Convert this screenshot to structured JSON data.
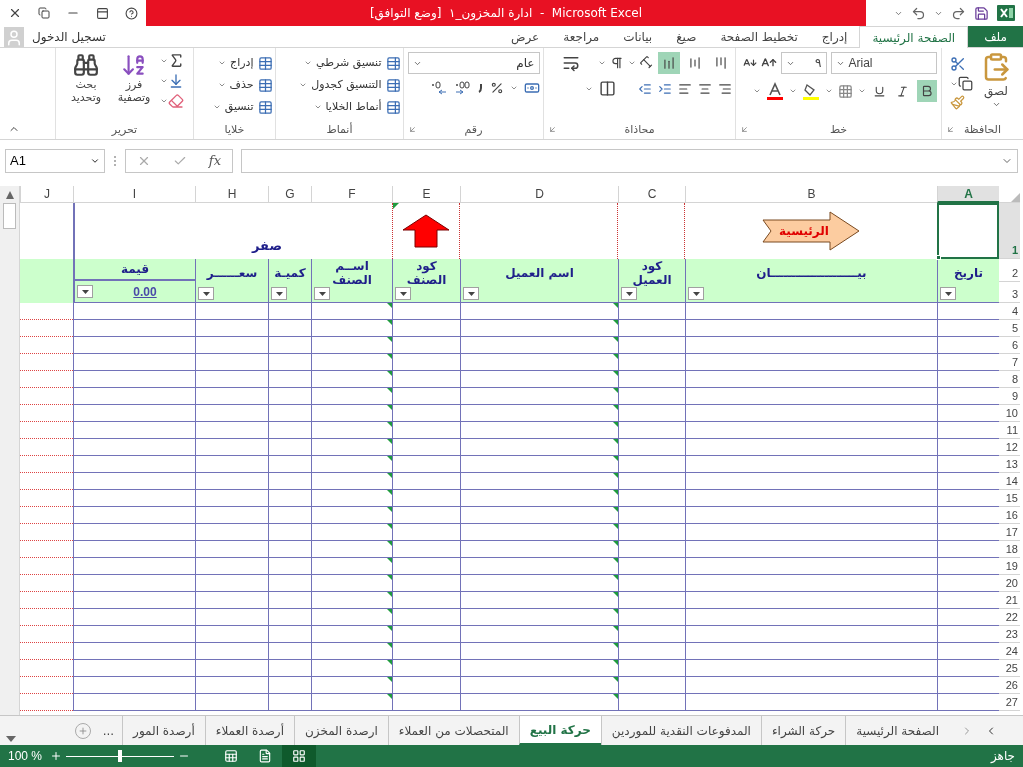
{
  "window": {
    "title": "ادارة المخزون_١  [وضع التوافق]  -  Microsoft Excel"
  },
  "account": {
    "label": "تسجيل الدخول"
  },
  "ribbon_tabs": [
    {
      "label": "ملف",
      "kind": "file",
      "selected": false
    },
    {
      "label": "الصفحة الرئيسية",
      "kind": "tab",
      "selected": true
    },
    {
      "label": "إدراج",
      "kind": "tab",
      "selected": false
    },
    {
      "label": "تخطيط الصفحة",
      "kind": "tab",
      "selected": false
    },
    {
      "label": "صيغ",
      "kind": "tab",
      "selected": false
    },
    {
      "label": "بيانات",
      "kind": "tab",
      "selected": false
    },
    {
      "label": "مراجعة",
      "kind": "tab",
      "selected": false
    },
    {
      "label": "عرض",
      "kind": "tab",
      "selected": false
    }
  ],
  "ribbon": {
    "clipboard": {
      "label": "الحافظة",
      "paste": "لصق"
    },
    "font": {
      "label": "خط",
      "font_name": "Arial",
      "font_size": "٩",
      "bold": true,
      "italic": false,
      "underline": false
    },
    "alignment": {
      "label": "محاذاة",
      "vertical_align": [
        {
          "kind": "top",
          "selected": false
        },
        {
          "kind": "middle",
          "selected": false
        },
        {
          "kind": "bottom",
          "selected": true
        }
      ]
    },
    "number": {
      "label": "رقم",
      "format": "عام"
    },
    "styles": {
      "label": "أنماط",
      "items": [
        "تنسيق شرطي",
        "التنسيق كجدول",
        "أنماط الخلايا"
      ]
    },
    "cells": {
      "label": "خلايا",
      "items": [
        "إدراج",
        "حذف",
        "تنسيق"
      ]
    },
    "editing": {
      "label": "تحرير",
      "sort": "فرز وتصفية",
      "find": "بحث وتحديد"
    }
  },
  "formula_bar": {
    "name_box": "A1",
    "function_button": "fx"
  },
  "columns": [
    {
      "label": "A",
      "selected": true
    },
    {
      "label": "B",
      "selected": false
    },
    {
      "label": "C",
      "selected": false
    },
    {
      "label": "D",
      "selected": false
    },
    {
      "label": "E",
      "selected": false
    },
    {
      "label": "F",
      "selected": false
    },
    {
      "label": "G",
      "selected": false
    },
    {
      "label": "H",
      "selected": false
    },
    {
      "label": "I",
      "selected": false
    },
    {
      "label": "J",
      "selected": false
    }
  ],
  "row_headers": [
    {
      "label": "1",
      "selected": true
    },
    {
      "label": "2",
      "selected": false
    },
    {
      "label": "3",
      "selected": false
    },
    {
      "label": "4",
      "selected": false
    },
    {
      "label": "5",
      "selected": false
    },
    {
      "label": "6",
      "selected": false
    },
    {
      "label": "7",
      "selected": false
    },
    {
      "label": "8",
      "selected": false
    },
    {
      "label": "9",
      "selected": false
    },
    {
      "label": "10",
      "selected": false
    },
    {
      "label": "11",
      "selected": false
    },
    {
      "label": "12",
      "selected": false
    },
    {
      "label": "13",
      "selected": false
    },
    {
      "label": "14",
      "selected": false
    },
    {
      "label": "15",
      "selected": false
    },
    {
      "label": "16",
      "selected": false
    },
    {
      "label": "17",
      "selected": false
    },
    {
      "label": "18",
      "selected": false
    },
    {
      "label": "19",
      "selected": false
    },
    {
      "label": "20",
      "selected": false
    },
    {
      "label": "21",
      "selected": false
    },
    {
      "label": "22",
      "selected": false
    },
    {
      "label": "23",
      "selected": false
    },
    {
      "label": "24",
      "selected": false
    },
    {
      "label": "25",
      "selected": false
    },
    {
      "label": "26",
      "selected": false
    },
    {
      "label": "27",
      "selected": false
    }
  ],
  "top_row": {
    "home_link": "الرئيسية",
    "total_text": "صفر"
  },
  "header_cells": [
    {
      "label": "تاريخ"
    },
    {
      "label": "بيـــــــــــــــــــــان"
    },
    {
      "label": "كود العميل"
    },
    {
      "label": "اسم العميل"
    },
    {
      "label": "كود الصنف"
    },
    {
      "label": "اســم الصنف"
    },
    {
      "label": "كميـة"
    },
    {
      "label": "سعــــــر"
    },
    {
      "label": "قيمة",
      "value": "0.00"
    }
  ],
  "sheet_tabs": [
    {
      "label": "الصفحة الرئيسية",
      "selected": false
    },
    {
      "label": "حركة الشراء",
      "selected": false
    },
    {
      "label": "المدفوعات النقدية للموردين",
      "selected": false
    },
    {
      "label": "حركة البيع",
      "selected": true
    },
    {
      "label": "المتحصلات من العملاء",
      "selected": false
    },
    {
      "label": "ارصدة المخزن",
      "selected": false
    },
    {
      "label": "أرصدة العملاء",
      "selected": false
    },
    {
      "label": "أرصدة المور",
      "selected": false
    }
  ],
  "more_tabs": "...",
  "status_bar": {
    "status": "جاهز",
    "zoom": "100 %",
    "zoom_level": {
      "level": 0.5
    },
    "views": [
      {
        "kind": "normal",
        "selected": true
      },
      {
        "kind": "page_layout",
        "selected": false
      },
      {
        "kind": "page_break",
        "selected": false
      }
    ]
  }
}
